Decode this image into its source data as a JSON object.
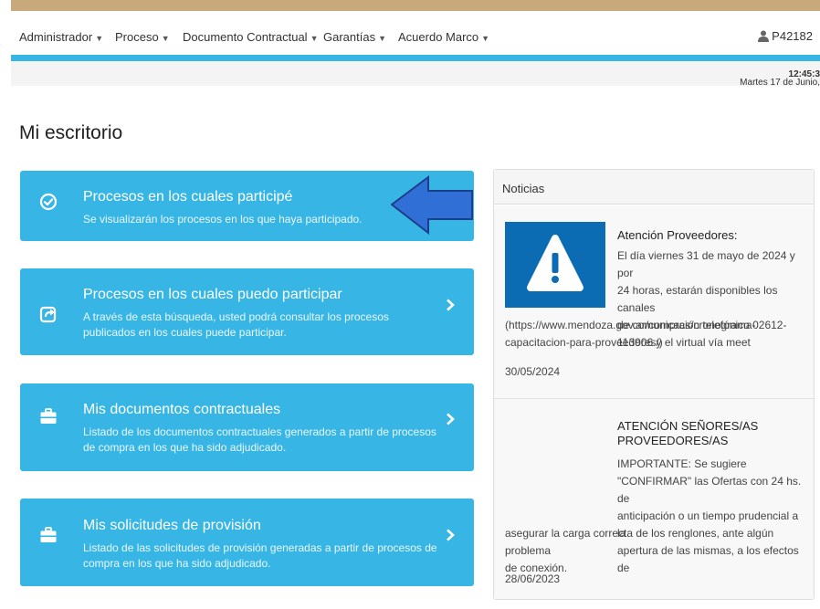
{
  "nav": {
    "items": [
      {
        "label": "Administrador"
      },
      {
        "label": "Proceso"
      },
      {
        "label": "Documento Contractual"
      },
      {
        "label": "Garantías"
      },
      {
        "label": "Acuerdo Marco"
      }
    ],
    "user": "P42182"
  },
  "datebar": {
    "date": "Martes 17 de Junio,",
    "time": "12:45:3"
  },
  "page_title": "Mi escritorio",
  "cards": [
    {
      "title": "Procesos en los cuales participé",
      "description": "Se visualizarán los procesos en los que haya participado.",
      "icon": "check-circle-icon"
    },
    {
      "title": "Procesos en los cuales puedo participar",
      "description": "A través de esta búsqueda, usted podrá consultar los procesos publicados en los cuales puede participar.",
      "icon": "share-square-icon"
    },
    {
      "title": "Mis documentos contractuales",
      "description": "Listado de los documentos contractuales generados a partir de procesos de compra en los que ha sido adjudicado.",
      "icon": "briefcase-icon"
    },
    {
      "title": "Mis solicitudes de provisión",
      "description": "Listado de las solicitudes de provisión generadas a partir de procesos de compra en los que ha sido adjudicado.",
      "icon": "briefcase-icon"
    }
  ],
  "news": {
    "header": "Noticias",
    "items": [
      {
        "title": "Atención Proveedores:",
        "text_lines": [
          "El día viernes 31 de mayo de 2024 y por",
          "24 horas, estarán disponibles los canales",
          "de comunicación telefónico 02612-",
          "113906 y el virtual vía meet"
        ],
        "text_full_lines": [
          "(https://www.mendoza.gov.ar/compras/cronograma-",
          "capacitacion-para-proveedores/)"
        ],
        "date": "30/05/2024"
      },
      {
        "title": "ATENCIÓN SEÑORES/AS PROVEEDORES/AS",
        "text_lines": [
          "IMPORTANTE: Se sugiere",
          "\"CONFIRMAR\" las Ofertas con 24 hs. de",
          "anticipación o un tiempo prudencial a la",
          "apertura de las mismas, a los efectos de"
        ],
        "text_full_lines": [
          "asegurar la carga correcta de los renglones, ante algún problema",
          "de conexión."
        ],
        "date": "28/06/2023"
      }
    ]
  },
  "colors": {
    "accent": "#37b6e6",
    "top_border": "#c7a97b",
    "warning_box": "#0c6cb3",
    "annotation_arrow": "#2f6fd6"
  }
}
